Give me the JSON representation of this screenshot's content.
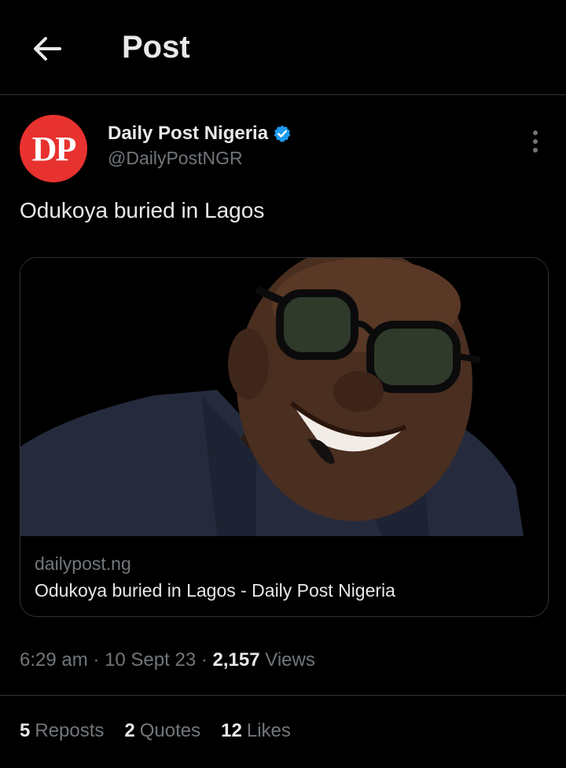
{
  "header": {
    "title": "Post",
    "back_icon": "arrow-left-icon"
  },
  "author": {
    "avatar_text": "DP",
    "avatar_color": "#e8322f",
    "name": "Daily Post Nigeria",
    "handle": "@DailyPostNGR",
    "verified_icon": "verified-badge-icon",
    "verified_color": "#1d9bf0"
  },
  "post": {
    "text": "Odukoya buried in Lagos",
    "card": {
      "image_alt": "Photo of smiling man in glasses",
      "domain": "dailypost.ng",
      "title": "Odukoya buried in Lagos - Daily Post Nigeria"
    },
    "time": "6:29 am",
    "date": "10 Sept 23",
    "views_count": "2,157",
    "views_label": "Views"
  },
  "stats": {
    "reposts_count": "5",
    "reposts_label": "Reposts",
    "quotes_count": "2",
    "quotes_label": "Quotes",
    "likes_count": "12",
    "likes_label": "Likes"
  },
  "colors": {
    "background": "#000000",
    "text": "#e7e9ea",
    "secondary": "#71767b",
    "border": "#2f3336"
  }
}
